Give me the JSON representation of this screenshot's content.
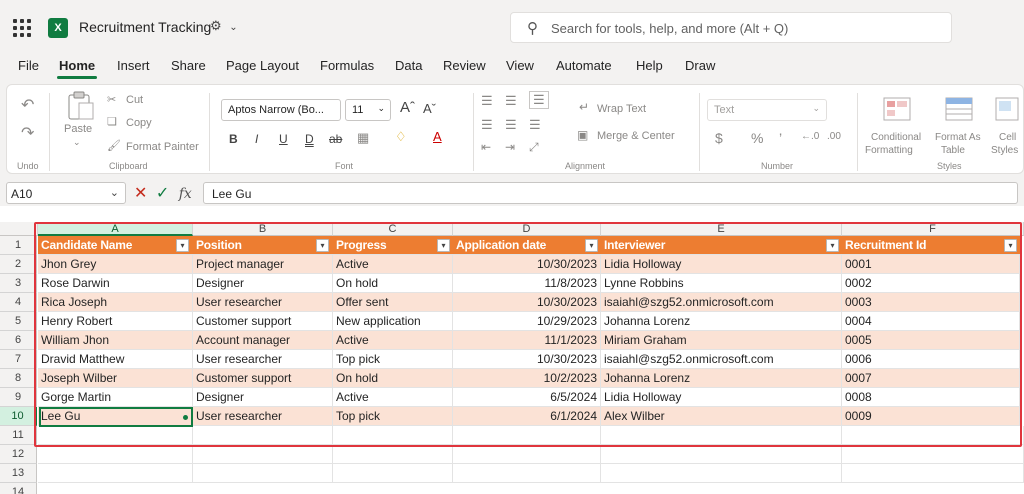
{
  "app": {
    "title": "Recruitment Tracking",
    "search_placeholder": "Search for tools, help, and more (Alt + Q)"
  },
  "menu": [
    "File",
    "Home",
    "Insert",
    "Share",
    "Page Layout",
    "Formulas",
    "Data",
    "Review",
    "View",
    "Automate",
    "Help",
    "Draw"
  ],
  "ribbon": {
    "undo_group": "Undo",
    "clipboard": {
      "paste": "Paste",
      "cut": "Cut",
      "copy": "Copy",
      "format_painter": "Format Painter",
      "group": "Clipboard"
    },
    "font": {
      "name": "Aptos Narrow (Bo...",
      "size": "11",
      "group": "Font"
    },
    "alignment": {
      "wrap": "Wrap Text",
      "merge": "Merge & Center",
      "group": "Alignment"
    },
    "number": {
      "format": "Text",
      "group": "Number"
    },
    "styles": {
      "conditional": "Conditional",
      "conditional2": "Formatting",
      "format_as": "Format As",
      "format_as2": "Table",
      "cell": "Cell",
      "cell2": "Styles",
      "group": "Styles"
    }
  },
  "formula_bar": {
    "cell_ref": "A10",
    "value": "Lee Gu"
  },
  "sheet": {
    "columns": [
      "A",
      "B",
      "C",
      "D",
      "E",
      "F"
    ],
    "headers": [
      "Candidate Name",
      "Position",
      "Progress",
      "Application date",
      "Interviewer",
      "Recruitment Id"
    ],
    "rows": [
      [
        "Jhon Grey",
        "Project manager",
        "Active",
        "10/30/2023",
        "Lidia Holloway",
        "0001"
      ],
      [
        "Rose Darwin",
        "Designer",
        "On hold",
        "11/8/2023",
        "Lynne Robbins",
        "0002"
      ],
      [
        "Rica Joseph",
        "User researcher",
        "Offer sent",
        "10/30/2023",
        "isaiahl@szg52.onmicrosoft.com",
        "0003"
      ],
      [
        "Henry Robert",
        "Customer support",
        "New application",
        "10/29/2023",
        "Johanna Lorenz",
        "0004"
      ],
      [
        "William Jhon",
        "Account manager",
        "Active",
        "11/1/2023",
        "Miriam Graham",
        "0005"
      ],
      [
        "Dravid Matthew",
        "User researcher",
        "Top pick",
        "10/30/2023",
        "isaiahl@szg52.onmicrosoft.com",
        "0006"
      ],
      [
        "Joseph Wilber",
        "Customer support",
        "On hold",
        "10/2/2023",
        "Johanna Lorenz",
        "0007"
      ],
      [
        "Gorge Martin",
        "Designer",
        "Active",
        "6/5/2024",
        "Lidia Holloway",
        "0008"
      ],
      [
        "Lee Gu",
        "User researcher",
        "Top pick",
        "6/1/2024",
        "Alex Wilber",
        "0009"
      ]
    ],
    "row_numbers": [
      "1",
      "2",
      "3",
      "4",
      "5",
      "6",
      "7",
      "8",
      "9",
      "10",
      "11",
      "12",
      "13",
      "14"
    ],
    "selected_cell": "A10"
  },
  "colors": {
    "header_fill": "#ed7d31",
    "band_fill": "#fbe2d5",
    "accent": "#107c41",
    "highlight_frame": "#e0353d"
  }
}
